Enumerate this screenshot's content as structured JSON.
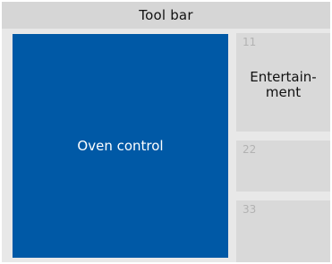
{
  "toolbar": {
    "title": "Tool bar"
  },
  "main_tile": {
    "label": "Oven control",
    "color": "#0059a6"
  },
  "side_tiles": [
    {
      "number": "11",
      "label_line1": "Entertain-",
      "label_line2": "ment"
    },
    {
      "number": "22",
      "label_line1": "",
      "label_line2": ""
    },
    {
      "number": "33",
      "label_line1": "",
      "label_line2": ""
    }
  ]
}
